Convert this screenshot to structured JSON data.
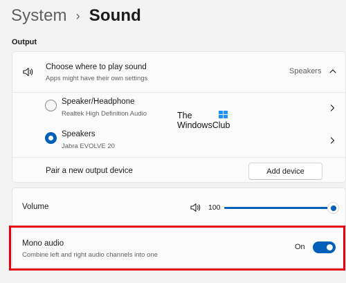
{
  "breadcrumb": {
    "parent": "System",
    "separator": "›",
    "current": "Sound"
  },
  "output": {
    "section_label": "Output",
    "choose_title": "Choose where to play sound",
    "choose_subtitle": "Apps might have their own settings",
    "selected_device": "Speakers",
    "devices": [
      {
        "name": "Speaker/Headphone",
        "detail": "Realtek High Definition Audio",
        "selected": false
      },
      {
        "name": "Speakers",
        "detail": "Jabra EVOLVE 20",
        "selected": true
      }
    ],
    "pair_label": "Pair a new output device",
    "add_device_label": "Add device"
  },
  "volume": {
    "label": "Volume",
    "value": "100",
    "level_percent": 100
  },
  "mono": {
    "title": "Mono audio",
    "subtitle": "Combine left and right audio channels into one",
    "state_label": "On",
    "enabled": true
  },
  "watermark": {
    "line1": "The",
    "line2": "WindowsClub"
  },
  "colors": {
    "accent": "#005fb8",
    "highlight": "#e3000f",
    "background": "#f3f3f3"
  },
  "icons": [
    "speaker-icon",
    "chevron-up-icon",
    "chevron-right-icon",
    "volume-icon"
  ]
}
